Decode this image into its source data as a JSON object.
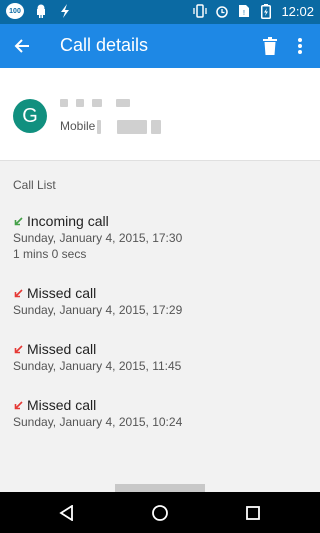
{
  "status_bar": {
    "battery_badge": "100",
    "time": "12:02"
  },
  "app_bar": {
    "title": "Call details"
  },
  "contact": {
    "initial": "G",
    "type_label": "Mobile"
  },
  "call_list": {
    "header": "Call List",
    "entries": [
      {
        "type": "Incoming call",
        "date": "Sunday, January 4, 2015, 17:30",
        "duration": "1 mins 0 secs",
        "arrow_color": "#43a047"
      },
      {
        "type": "Missed call",
        "date": "Sunday, January 4, 2015, 17:29",
        "arrow_color": "#e53935"
      },
      {
        "type": "Missed call",
        "date": "Sunday, January 4, 2015, 11:45",
        "arrow_color": "#e53935"
      },
      {
        "type": "Missed call",
        "date": "Sunday, January 4, 2015, 10:24",
        "arrow_color": "#e53935"
      }
    ]
  },
  "colors": {
    "status_bar": "#0b6aa3",
    "app_bar": "#1e88e5",
    "avatar": "#11907f"
  }
}
